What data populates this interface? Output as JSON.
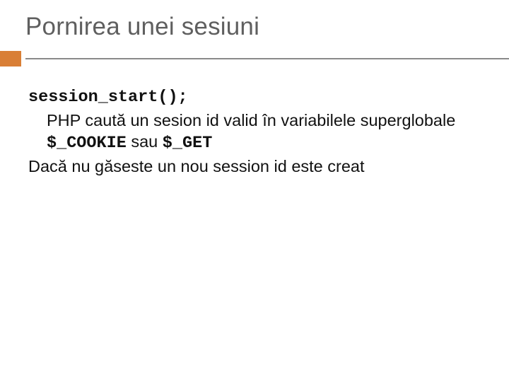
{
  "title": "Pornirea unei sesiuni",
  "code_fn": "session_start",
  "code_args": "();",
  "line1a": "PHP caută un sesion id valid în variabilele superglobale ",
  "var1": "$_COOKIE",
  "line1b": " sau ",
  "var2": "$_GET",
  "line2": "Dacă nu găseste un nou session id este creat"
}
